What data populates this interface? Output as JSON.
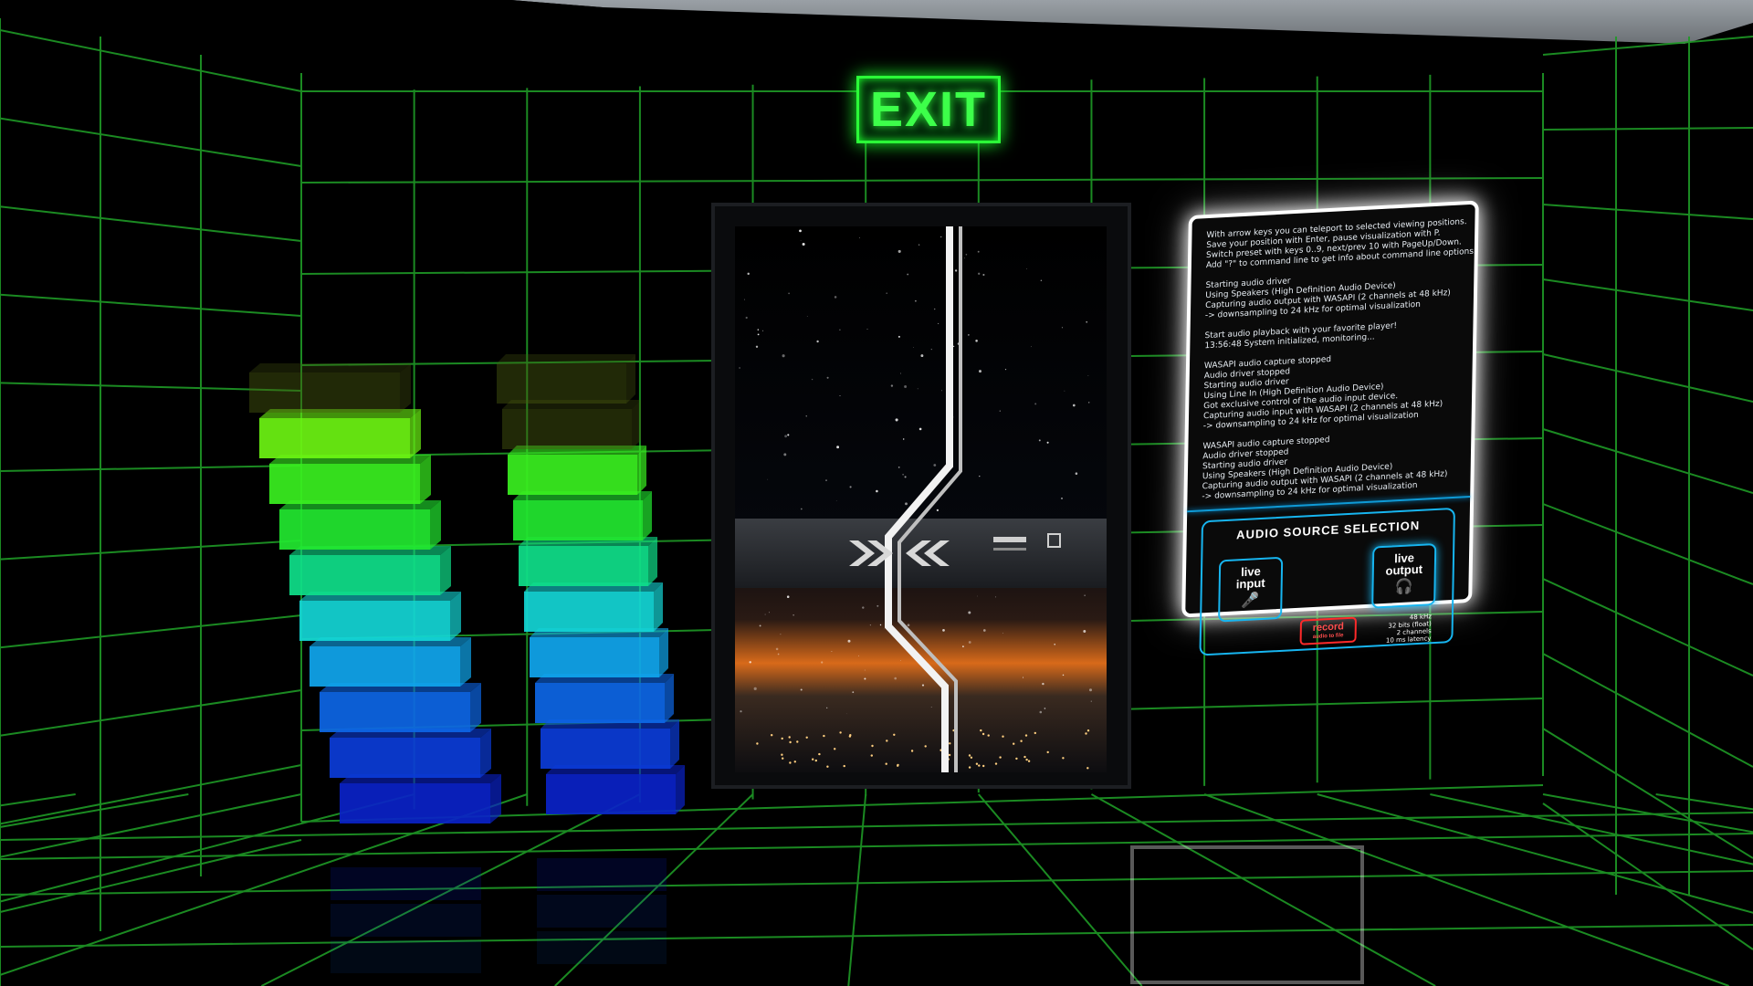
{
  "exit_sign": {
    "label": "EXIT"
  },
  "info_panel": {
    "log_lines": [
      "With arrow keys you can teleport to selected viewing positions.",
      "Save your position with Enter, pause visualization with P.",
      "Switch preset with keys 0..9, next/prev 10 with PageUp/Down.",
      "Add \"?\" to command line to get info about command line options.",
      "",
      "Starting audio driver",
      "Using Speakers (High Definition Audio Device)",
      "Capturing audio output with WASAPI (2 channels at 48 kHz)",
      "-> downsampling to 24 kHz for optimal visualization",
      "",
      "Start audio playback with your favorite player!",
      "13:56:48 System initialized, monitoring...",
      "",
      "WASAPI audio capture stopped",
      "Audio driver stopped",
      "Starting audio driver",
      "Using Line In (High Definition Audio Device)",
      "Got exclusive control of the audio input device.",
      "Capturing audio input with WASAPI (2 channels at 48 kHz)",
      "-> downsampling to 24 kHz for optimal visualization",
      "",
      "WASAPI audio capture stopped",
      "Audio driver stopped",
      "Starting audio driver",
      "Using Speakers (High Definition Audio Device)",
      "Capturing audio output with WASAPI (2 channels at 48 kHz)",
      "-> downsampling to 24 kHz for optimal visualization"
    ],
    "audio_source": {
      "title": "AUDIO SOURCE SELECTION",
      "live_input": {
        "line1": "live",
        "line2": "input"
      },
      "live_output": {
        "line1": "live",
        "line2": "output"
      },
      "record": {
        "label": "record",
        "sub": "audio to file"
      },
      "specs": [
        "48 kHz",
        "32 bits (float)",
        "2 channels",
        "10 ms latency"
      ]
    }
  },
  "level_meters": {
    "left_active": 9,
    "right_active": 8,
    "segments": 10,
    "colors": [
      "#0a22c8",
      "#0b3cd8",
      "#0d66e6",
      "#10a6ee",
      "#14d6d6",
      "#0fe08a",
      "#22e830",
      "#39f020",
      "#6cf412",
      "#8dfb10"
    ]
  },
  "door": {
    "icon": "chevron-logo-icon"
  }
}
